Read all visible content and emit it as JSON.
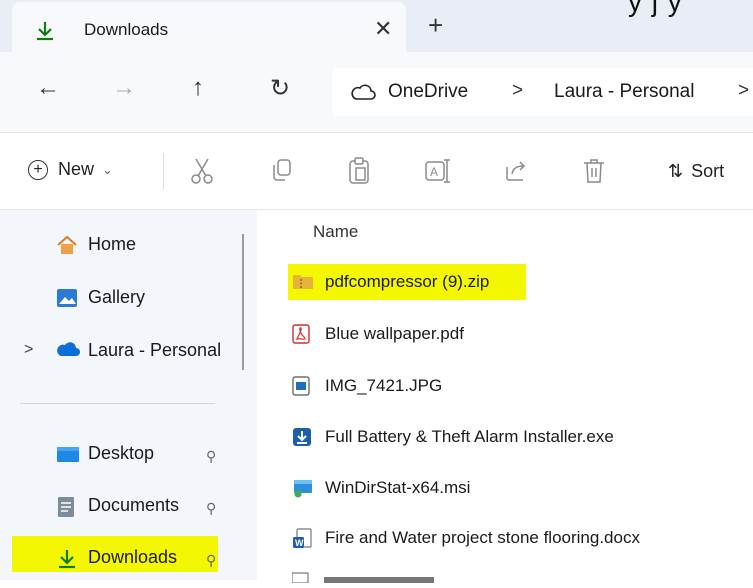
{
  "tab": {
    "title": "Downloads",
    "close": "✕",
    "new_tab": "+"
  },
  "top_cutoff_text": "y j y",
  "nav": {
    "back": "←",
    "forward": "→",
    "up": "↑",
    "refresh": "↻"
  },
  "address": {
    "crumbs": [
      "OneDrive",
      "Laura - Personal"
    ],
    "separators": [
      ">",
      ">"
    ]
  },
  "toolbar": {
    "new_label": "New",
    "new_chevron": "⌄",
    "sort_label": "Sort",
    "icons": [
      "cut-icon",
      "copy-icon",
      "paste-icon",
      "rename-icon",
      "share-icon",
      "delete-icon"
    ]
  },
  "sidebar": {
    "items": [
      {
        "label": "Home",
        "icon": "home-icon"
      },
      {
        "label": "Gallery",
        "icon": "gallery-icon"
      },
      {
        "label": "Laura - Personal",
        "icon": "onedrive-cloud-icon"
      },
      {
        "label": "Desktop",
        "icon": "desktop-icon"
      },
      {
        "label": "Documents",
        "icon": "documents-icon"
      },
      {
        "label": "Downloads",
        "icon": "download-icon"
      }
    ],
    "expand_chevron": ">",
    "pin": "📌"
  },
  "main": {
    "column_name": "Name",
    "files": [
      {
        "name": "pdfcompressor (9).zip",
        "icon": "zip-folder-icon",
        "highlighted": true
      },
      {
        "name": "Blue wallpaper.pdf",
        "icon": "pdf-icon"
      },
      {
        "name": "IMG_7421.JPG",
        "icon": "image-icon"
      },
      {
        "name": "Full Battery & Theft Alarm Installer.exe",
        "icon": "installer-icon"
      },
      {
        "name": "WinDirStat-x64.msi",
        "icon": "msi-icon"
      },
      {
        "name": "Fire and Water project stone flooring.docx",
        "icon": "word-doc-icon"
      }
    ]
  },
  "colors": {
    "highlight": "#f3f700",
    "accent": "#107c10",
    "onedrive": "#0a6fd6"
  }
}
